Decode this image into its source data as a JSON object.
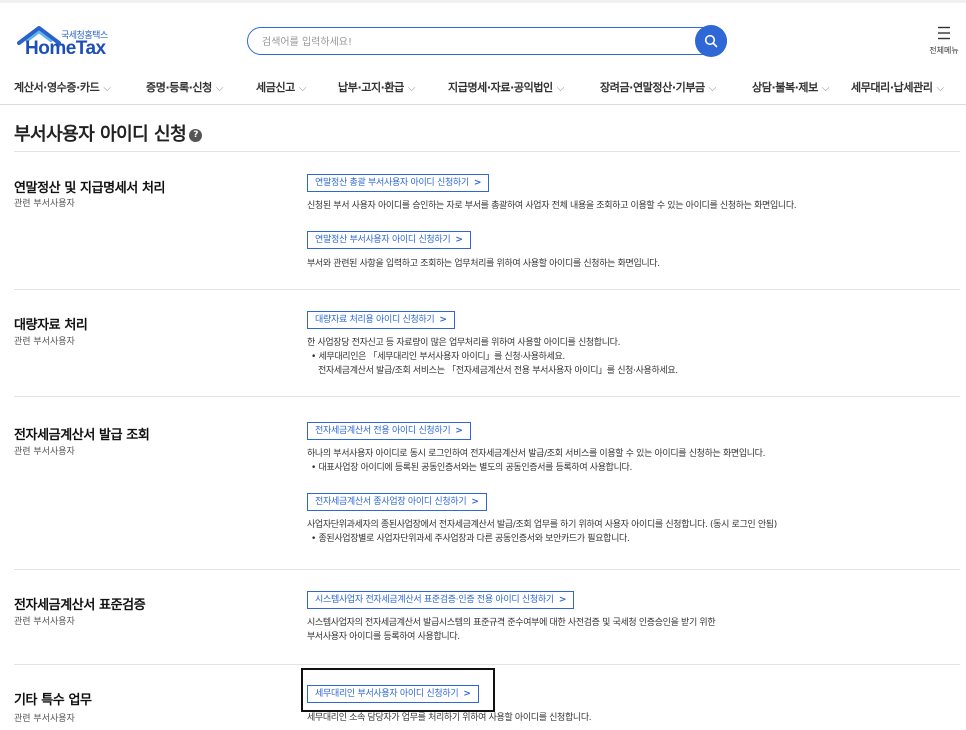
{
  "header": {
    "logo_small": "국세청홈택스",
    "logo_main": "HomeTax",
    "search_placeholder": "검색어를 입력하세요!",
    "menu_all_label": "전체메뉴"
  },
  "nav": [
    {
      "label": "계산서·영수증·카드"
    },
    {
      "label": "증명·등록·신청"
    },
    {
      "label": "세금신고"
    },
    {
      "label": "납부·고지·환급"
    },
    {
      "label": "지급명세·자료·공익법인"
    },
    {
      "label": "장려금·연말정산·기부금"
    },
    {
      "label": "상담·불복·제보"
    },
    {
      "label": "세무대리·납세관리"
    }
  ],
  "page": {
    "title": "부서사용자 아이디 신청"
  },
  "sections": [
    {
      "title": "연말정산 및 지급명세서 처리",
      "sub": "관련 부서사용자",
      "items": [
        {
          "button": "연말정산 총괄 부서사용자 아이디 신청하기",
          "desc": [
            "신청된 부서 사용자 아이디를 승인하는 자로 부서를 총괄하여 사업자 전체 내용을 조회하고 이용할 수 있는 아이디를 신청하는 화면입니다."
          ]
        },
        {
          "button": "연말정산 부서사용자 아이디 신청하기",
          "desc": [
            "부서와 관련된 사항을 입력하고 조회하는 업무처리를 위하여 사용할 아이디를 신청하는 화면입니다."
          ]
        }
      ]
    },
    {
      "title": "대량자료 처리",
      "sub": "관련 부서사용자",
      "items": [
        {
          "button": "대량자료 처리용 아이디 신청하기",
          "desc": [
            "한 사업장당 전자신고 등 자료량이 많은 업무처리를 위하여 사용할 아이디를 신청합니다.",
            "• 세무대리인은 「세무대리인 부서사용자 아이디」를 신청·사용하세요.",
            "전자세금계산서 발급/조회 서비스는 「전자세금계산서 전용 부서사용자 아이디」를 신청·사용하세요."
          ]
        }
      ]
    },
    {
      "title": "전자세금계산서 발급 조회",
      "sub": "관련 부서사용자",
      "items": [
        {
          "button": "전자세금계산서 전용 아이디 신청하기",
          "desc": [
            "하나의 부서사용자 아이디로 동시 로그인하여 전자세금계산서 발급/조회 서비스를 이용할 수 있는 아이디를 신청하는 화면입니다.",
            "• 대표사업장 아이디에 등록된 공동인증서와는 별도의 공동인증서를 등록하여 사용합니다."
          ]
        },
        {
          "button": "전자세금계산서 종사업장 아이디 신청하기",
          "desc": [
            "사업자단위과세자의 종된사업장에서 전자세금계산서 발급/조회 업무를 하기 위하여 사용자 아이디를 신청합니다. (동시 로그인 안됨)",
            "• 종된사업장별로 사업자단위과세 주사업장과 다른 공동인증서와 보안카드가 필요합니다."
          ]
        }
      ]
    },
    {
      "title": "전자세금계산서 표준검증",
      "sub": "관련 부서사용자",
      "items": [
        {
          "button": "시스템사업자 전자세금계산서 표준검증·인증 전용 아이디 신청하기",
          "desc": [
            "시스템사업자의 전자세금계산서 발급시스템의 표준규격 준수여부에 대한 사전검증 및 국세청 인증승인을 받기 위한",
            "부서사용자 아이디를 등록하여 사용합니다."
          ]
        }
      ]
    },
    {
      "title": "기타 특수 업무",
      "sub": "관련 부서사용자",
      "items": [
        {
          "button": "세무대리인 부서사용자 아이디 신청하기",
          "desc": [
            "세무대리인 소속 담당자가 업무를 처리하기 위하여 사용할 아이디를 신청합니다."
          ]
        }
      ]
    }
  ],
  "colors": {
    "accent": "#2f67d6",
    "logo": "#1e4fb7"
  },
  "icons": [
    "home-roof-icon",
    "search-icon",
    "hamburger-icon",
    "chevron-down-icon",
    "help-icon",
    "chevron-right-icon"
  ]
}
